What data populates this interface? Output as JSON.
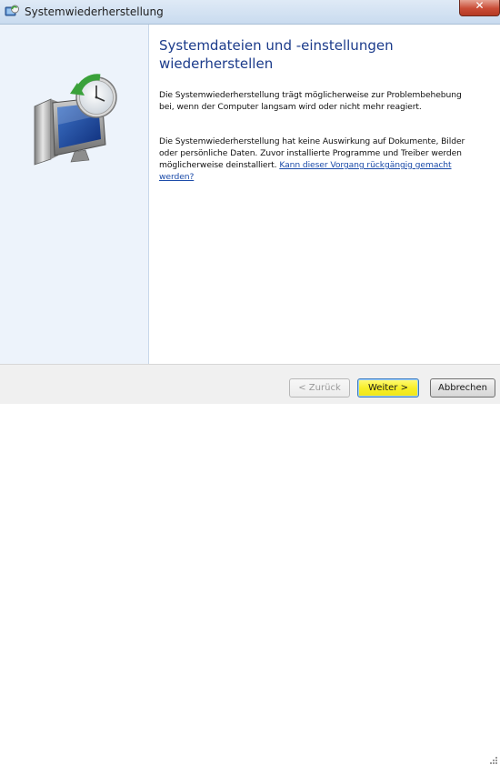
{
  "window": {
    "title": "Systemwiederherstellung",
    "close_glyph": "✕"
  },
  "sidebar": {
    "illustration_icon": "system-restore-icon"
  },
  "main": {
    "heading": "Systemdateien und -einstellungen\nwiederherstellen",
    "paragraph1": "Die Systemwiederherstellung trägt möglicherweise zur Problembehebung bei, wenn der Computer langsam wird oder nicht mehr reagiert.",
    "paragraph2": "Die Systemwiederherstellung hat keine Auswirkung auf Dokumente, Bilder oder persönliche Daten. Zuvor installierte Programme und Treiber werden möglicherweise deinstalliert.",
    "undo_link": "Kann dieser Vorgang rückgängig gemacht werden?"
  },
  "footer": {
    "back_label": "< Zurück",
    "next_label": "Weiter >",
    "cancel_label": "Abbrechen"
  },
  "colors": {
    "heading": "#1b3b8b",
    "link": "#1a4aa8",
    "sidebar_bg": "#edf3fb",
    "next_highlight": "#f7ef2a",
    "close_button": "#c94c36"
  }
}
